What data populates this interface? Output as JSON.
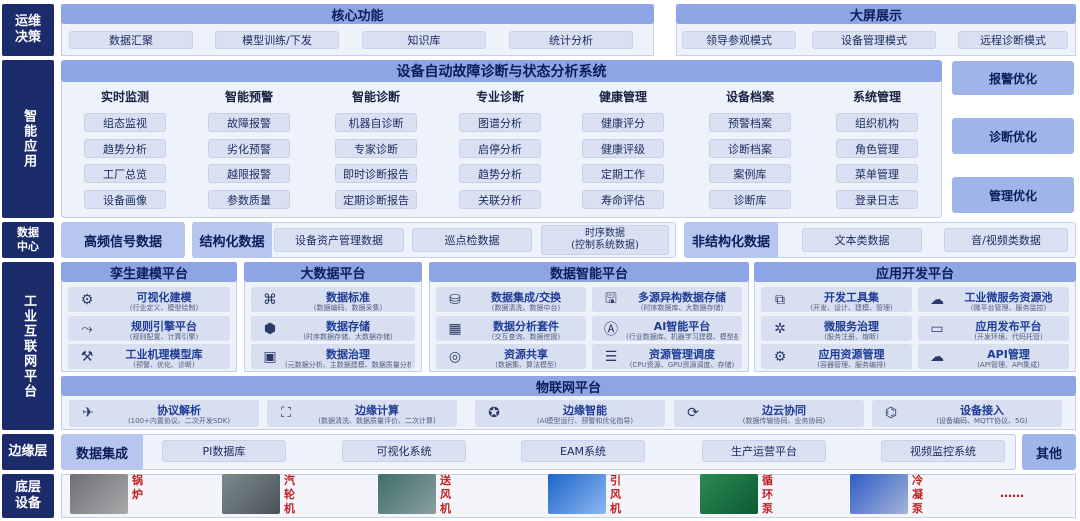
{
  "side_labels": {
    "ops": "运维决策",
    "smart": "智能应用",
    "data_center": "数据中心",
    "iiot": "工业互联网平台",
    "edge": "边缘层",
    "bottom": "底层设备"
  },
  "core": {
    "title": "核心功能",
    "items": [
      "数据汇聚",
      "模型训练/下发",
      "知识库",
      "统计分析"
    ]
  },
  "bigscreen": {
    "title": "大屏展示",
    "items": [
      "领导参观模式",
      "设备管理模式",
      "远程诊断模式"
    ]
  },
  "system": {
    "title": "设备自动故障诊断与状态分析系统",
    "columns": [
      {
        "head": "实时监测",
        "items": [
          "组态监视",
          "趋势分析",
          "工厂总览",
          "设备画像"
        ]
      },
      {
        "head": "智能预警",
        "items": [
          "故障报警",
          "劣化预警",
          "越限报警",
          "参数质量"
        ]
      },
      {
        "head": "智能诊断",
        "items": [
          "机器自诊断",
          "专家诊断",
          "即时诊断报告",
          "定期诊断报告"
        ]
      },
      {
        "head": "专业诊断",
        "items": [
          "图谱分析",
          "启停分析",
          "趋势分析",
          "关联分析"
        ]
      },
      {
        "head": "健康管理",
        "items": [
          "健康评分",
          "健康评级",
          "定期工作",
          "寿命评估"
        ]
      },
      {
        "head": "设备档案",
        "items": [
          "预警档案",
          "诊断档案",
          "案例库",
          "诊断库"
        ]
      },
      {
        "head": "系统管理",
        "items": [
          "组织机构",
          "角色管理",
          "菜单管理",
          "登录日志"
        ]
      }
    ]
  },
  "optimize": [
    "报警优化",
    "诊断优化",
    "管理优化"
  ],
  "datacenter": {
    "hf": "高频信号数据",
    "structured": "结构化数据",
    "structured_items": [
      "设备资产管理数据",
      "巡点检数据",
      "时序数据\n(控制系统数据)"
    ],
    "unstructured": "非结构化数据",
    "unstructured_items": [
      "文本类数据",
      "音/视频类数据"
    ]
  },
  "platforms": [
    {
      "title": "孪生建模平台",
      "cards": [
        {
          "icon": "gears-icon",
          "glyph": "⚙",
          "t": "可视化建模",
          "s": "(行业定义、模型绘制)"
        },
        {
          "icon": "rule-engine-icon",
          "glyph": "⤳",
          "t": "规则引擎平台",
          "s": "(规则配置、计算引擎)"
        },
        {
          "icon": "robot-arm-icon",
          "glyph": "⚒",
          "t": "工业机理模型库",
          "s": "(预警、优化、诊断)"
        }
      ]
    },
    {
      "title": "大数据平台",
      "cards": [
        {
          "icon": "network-icon",
          "glyph": "⌘",
          "t": "数据标准",
          "s": "(数据编码、数据采集)"
        },
        {
          "icon": "cube-icon",
          "glyph": "⬢",
          "t": "数据存储",
          "s": "(时序数据存储、大数据存储)"
        },
        {
          "icon": "monitor-gear-icon",
          "glyph": "▣",
          "t": "数据治理",
          "s": "(元数据分析、主数据建模、数据质量分析)"
        }
      ]
    },
    {
      "title": "数据智能平台",
      "cards": [
        {
          "icon": "database-icon",
          "glyph": "⛁",
          "t": "数据集成/交换",
          "s": "(数据清洗、数据中台)"
        },
        {
          "icon": "storage-icon",
          "glyph": "🖫",
          "t": "多源异构数据存储",
          "s": "(时序数据库、大数据存储)"
        },
        {
          "icon": "analysis-icon",
          "glyph": "▦",
          "t": "数据分析套件",
          "s": "(交互查询、数据挖掘)"
        },
        {
          "icon": "ai-icon",
          "glyph": "Ⓐ",
          "t": "AI智能平台",
          "s": "(行业数据库、机器学习建模、模型部署)"
        },
        {
          "icon": "disk-icon",
          "glyph": "◎",
          "t": "资源共享",
          "s": "(数据集、算法模型)"
        },
        {
          "icon": "layers-icon",
          "glyph": "☰",
          "t": "资源管理调度",
          "s": "(CPU资源、GPU资源调度、存储)"
        }
      ]
    },
    {
      "title": "应用开发平台",
      "cards": [
        {
          "icon": "toolbox-icon",
          "glyph": "⧉",
          "t": "开发工具集",
          "s": "(开发、设计、建模、管理)"
        },
        {
          "icon": "cloud-icon",
          "glyph": "☁",
          "t": "工业微服务资源池",
          "s": "(微平台管理、服务监控)"
        },
        {
          "icon": "microservice-icon",
          "glyph": "✲",
          "t": "微服务治理",
          "s": "(服务注册、熔断)"
        },
        {
          "icon": "laptop-icon",
          "glyph": "▭",
          "t": "应用发布平台",
          "s": "(开发环境、代码托管)"
        },
        {
          "icon": "resource-icon",
          "glyph": "⚙",
          "t": "应用资源管理",
          "s": "(容器管理、服务编排)"
        },
        {
          "icon": "api-cloud-icon",
          "glyph": "☁",
          "t": "API管理",
          "s": "(API管理、API集成)"
        }
      ]
    }
  ],
  "iot": {
    "title": "物联网平台",
    "cards": [
      {
        "icon": "satellite-icon",
        "glyph": "✈",
        "t": "协议解析",
        "s": "(100+内置协议、二次开发SDK)"
      },
      {
        "icon": "edge-compute-icon",
        "glyph": "⛶",
        "t": "边缘计算",
        "s": "(数据清洗、数据质量评价、二次计算)"
      },
      {
        "icon": "brain-icon",
        "glyph": "✪",
        "t": "边缘智能",
        "s": "(AI模型运行、预警和优化指导)"
      },
      {
        "icon": "sync-icon",
        "glyph": "⟳",
        "t": "边云协同",
        "s": "(数据传输协同、业务协同)"
      },
      {
        "icon": "router-icon",
        "glyph": "⌬",
        "t": "设备接入",
        "s": "(设备编码、MQTT协议、5G)"
      }
    ]
  },
  "edge": {
    "title": "数据集成",
    "items": [
      "PI数据库",
      "可视化系统",
      "EAM系统",
      "生产运营平台",
      "视频监控系统"
    ],
    "other": "其他"
  },
  "equipment": [
    {
      "label": "锅炉",
      "icon": "boiler-image"
    },
    {
      "label": "汽轮机",
      "icon": "turbine-image"
    },
    {
      "label": "送风机",
      "icon": "blower-image"
    },
    {
      "label": "引风机",
      "icon": "induced-fan-image"
    },
    {
      "label": "循环泵",
      "icon": "circulating-pump-image"
    },
    {
      "label": "冷凝泵",
      "icon": "condensate-pump-image"
    }
  ],
  "equipment_more": "……"
}
